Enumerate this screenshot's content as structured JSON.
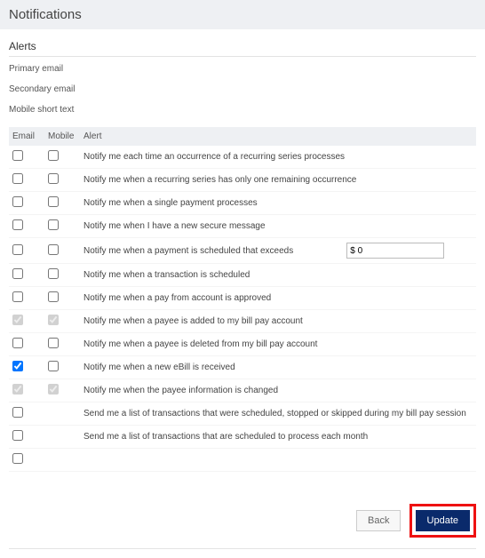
{
  "header": {
    "title": "Notifications"
  },
  "alerts_section": {
    "title": "Alerts",
    "primary_label": "Primary email",
    "secondary_label": "Secondary email",
    "mobile_label": "Mobile short text"
  },
  "table": {
    "columns": {
      "email": "Email",
      "mobile": "Mobile",
      "alert": "Alert"
    },
    "amount_value": "$ 0",
    "rows": [
      {
        "email_checked": false,
        "email_disabled": false,
        "mobile_checked": false,
        "mobile_disabled": false,
        "text": "Notify me each time an occurrence of a recurring series processes"
      },
      {
        "email_checked": false,
        "email_disabled": false,
        "mobile_checked": false,
        "mobile_disabled": false,
        "text": "Notify me when a recurring series has only one remaining occurrence"
      },
      {
        "email_checked": false,
        "email_disabled": false,
        "mobile_checked": false,
        "mobile_disabled": false,
        "text": "Notify me when a single payment processes"
      },
      {
        "email_checked": false,
        "email_disabled": false,
        "mobile_checked": false,
        "mobile_disabled": false,
        "text": "Notify me when I have a new secure message"
      },
      {
        "email_checked": false,
        "email_disabled": false,
        "mobile_checked": false,
        "mobile_disabled": false,
        "text": "Notify me when a payment is scheduled that exceeds",
        "has_amount": true
      },
      {
        "email_checked": false,
        "email_disabled": false,
        "mobile_checked": false,
        "mobile_disabled": false,
        "text": "Notify me when a transaction is scheduled"
      },
      {
        "email_checked": false,
        "email_disabled": false,
        "mobile_checked": false,
        "mobile_disabled": false,
        "text": "Notify me when a pay from account is approved"
      },
      {
        "email_checked": true,
        "email_disabled": true,
        "mobile_checked": true,
        "mobile_disabled": true,
        "text": "Notify me when a payee is added to my bill pay account"
      },
      {
        "email_checked": false,
        "email_disabled": false,
        "mobile_checked": false,
        "mobile_disabled": false,
        "text": "Notify me when a payee is deleted from my bill pay account"
      },
      {
        "email_checked": true,
        "email_disabled": false,
        "mobile_checked": false,
        "mobile_disabled": false,
        "text": "Notify me when a new eBill is received"
      },
      {
        "email_checked": true,
        "email_disabled": true,
        "mobile_checked": true,
        "mobile_disabled": true,
        "text": "Notify me when the payee information is changed"
      },
      {
        "email_checked": false,
        "email_disabled": false,
        "mobile_checked": null,
        "mobile_disabled": false,
        "text": "Send me a list of transactions that were scheduled, stopped or skipped during my bill pay session"
      },
      {
        "email_checked": false,
        "email_disabled": false,
        "mobile_checked": null,
        "mobile_disabled": false,
        "text": "Send me a list of transactions that are scheduled to process each month"
      },
      {
        "email_checked": false,
        "email_disabled": false,
        "mobile_checked": null,
        "mobile_disabled": false,
        "text": ""
      }
    ]
  },
  "footer": {
    "back_label": "Back",
    "update_label": "Update"
  }
}
